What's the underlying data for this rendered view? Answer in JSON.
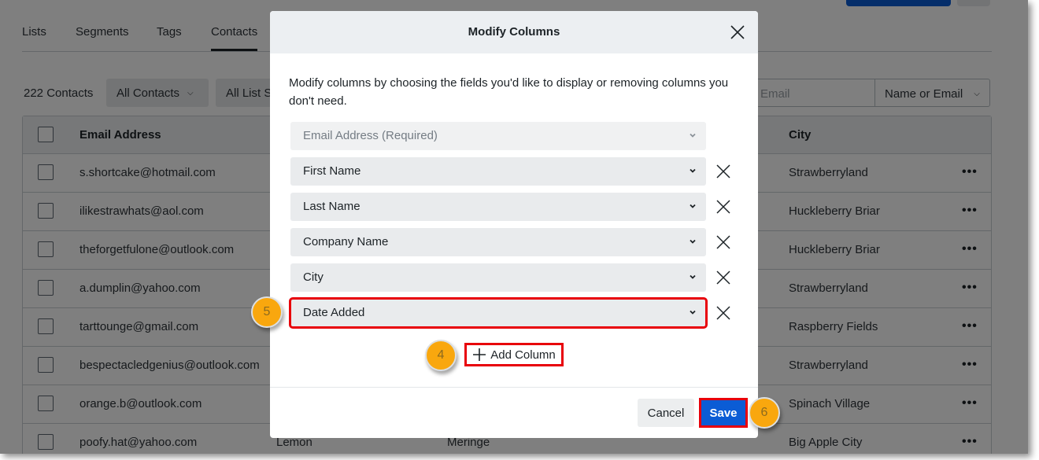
{
  "tabs": [
    {
      "label": "Lists",
      "active": false
    },
    {
      "label": "Segments",
      "active": false
    },
    {
      "label": "Tags",
      "active": false
    },
    {
      "label": "Contacts",
      "active": true
    }
  ],
  "filters": {
    "count_label": "222 Contacts",
    "contacts_filter": "All Contacts",
    "list_filter": "All List S",
    "search_placeholder": "Email",
    "search_type": "Name or Email"
  },
  "table": {
    "headers": {
      "email": "Email Address",
      "city": "City"
    },
    "rows": [
      {
        "email": "s.shortcake@hotmail.com",
        "first": "",
        "last": "",
        "city": "Strawberryland"
      },
      {
        "email": "ilikestrawhats@aol.com",
        "first": "",
        "last": "",
        "city": "Huckleberry Briar"
      },
      {
        "email": "theforgetfulone@outlook.com",
        "first": "",
        "last": "",
        "city": "Huckleberry Briar"
      },
      {
        "email": "a.dumplin@yahoo.com",
        "first": "",
        "last": "",
        "city": "Strawberryland"
      },
      {
        "email": "tarttounge@gmail.com",
        "first": "",
        "last": "",
        "city": "Raspberry Fields"
      },
      {
        "email": "bespectacledgenius@outlook.com",
        "first": "",
        "last": "",
        "city": "Strawberryland"
      },
      {
        "email": "orange.b@outlook.com",
        "first": "",
        "last": "",
        "city": "Spinach Village"
      },
      {
        "email": "poofy.hat@yahoo.com",
        "first": "Lemon",
        "last": "Meringe",
        "city": "Big Apple City"
      }
    ],
    "row_action_icon": "more-horizontal-icon"
  },
  "modal": {
    "title": "Modify Columns",
    "description": "Modify columns by choosing the fields you'd like to display or removing columns you don't need.",
    "fields": [
      {
        "label": "Email Address (Required)",
        "removable": false,
        "disabled": true
      },
      {
        "label": "First Name",
        "removable": true,
        "disabled": false
      },
      {
        "label": "Last Name",
        "removable": true,
        "disabled": false
      },
      {
        "label": "Company Name",
        "removable": true,
        "disabled": false
      },
      {
        "label": "City",
        "removable": true,
        "disabled": false
      },
      {
        "label": "Date Added",
        "removable": true,
        "disabled": false,
        "highlighted": true
      }
    ],
    "add_column_label": "Add Column",
    "cancel_label": "Cancel",
    "save_label": "Save"
  },
  "annotations": {
    "step_add_column": "4",
    "step_date_added": "5",
    "step_save": "6",
    "badge_color": "#f9a70e",
    "highlight_color": "#e8000a"
  },
  "colors": {
    "primary": "#0b5cd5",
    "overlay": "rgba(0,0,0,0.5)"
  }
}
